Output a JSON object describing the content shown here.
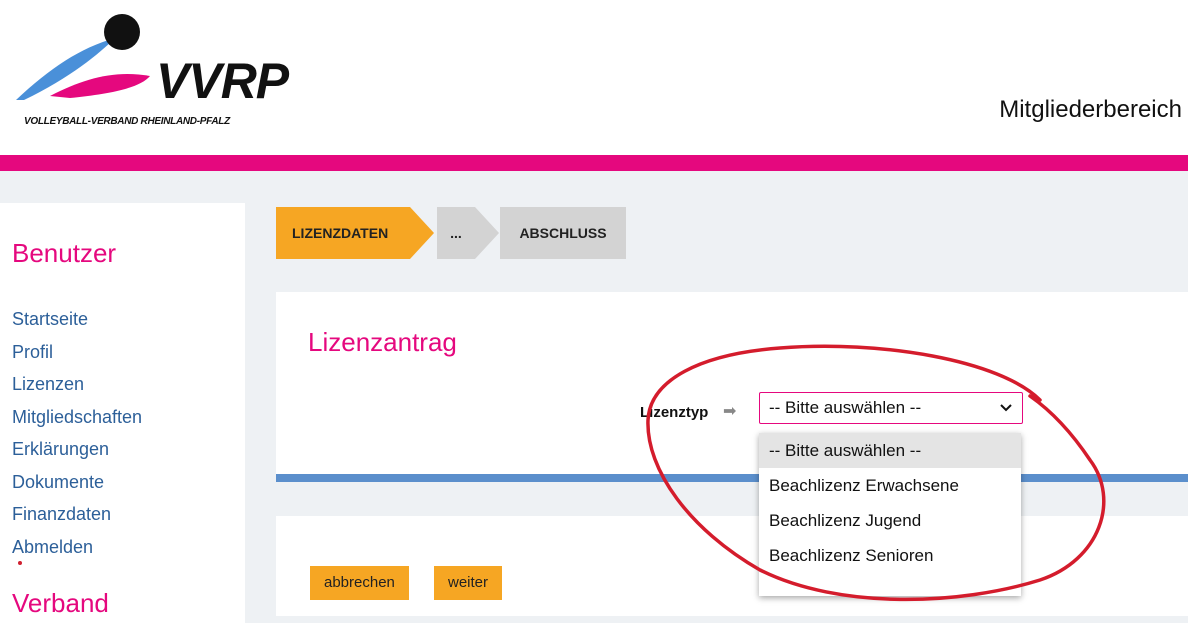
{
  "header": {
    "logo_text": "VVRP",
    "logo_sub": "VOLLEYBALL-VERBAND RHEINLAND-PFALZ",
    "member_area": "Mitgliederbereich"
  },
  "sidebar": {
    "title": "Benutzer",
    "items": [
      {
        "label": "Startseite"
      },
      {
        "label": "Profil"
      },
      {
        "label": "Lizenzen"
      },
      {
        "label": "Mitgliedschaften"
      },
      {
        "label": "Erklärungen"
      },
      {
        "label": "Dokumente"
      },
      {
        "label": "Finanzdaten"
      },
      {
        "label": "Abmelden"
      }
    ],
    "section2": "Verband"
  },
  "steps": [
    "LIZENZDATEN",
    "...",
    "ABSCHLUSS"
  ],
  "form": {
    "title": "Lizenzantrag",
    "license_type_label": "Lizenztyp",
    "arrow": "➡",
    "selected": "-- Bitte auswählen --",
    "options": [
      "-- Bitte auswählen --",
      "Beachlizenz Erwachsene",
      "Beachlizenz Jugend",
      "Beachlizenz Senioren"
    ]
  },
  "buttons": {
    "cancel": "abbrechen",
    "next": "weiter"
  },
  "colors": {
    "brand_pink": "#e5087e",
    "accent_orange": "#f6a623",
    "link_blue": "#2c5f99",
    "divider_blue": "#5b8fcc",
    "annotation_red": "#d41c2c"
  }
}
